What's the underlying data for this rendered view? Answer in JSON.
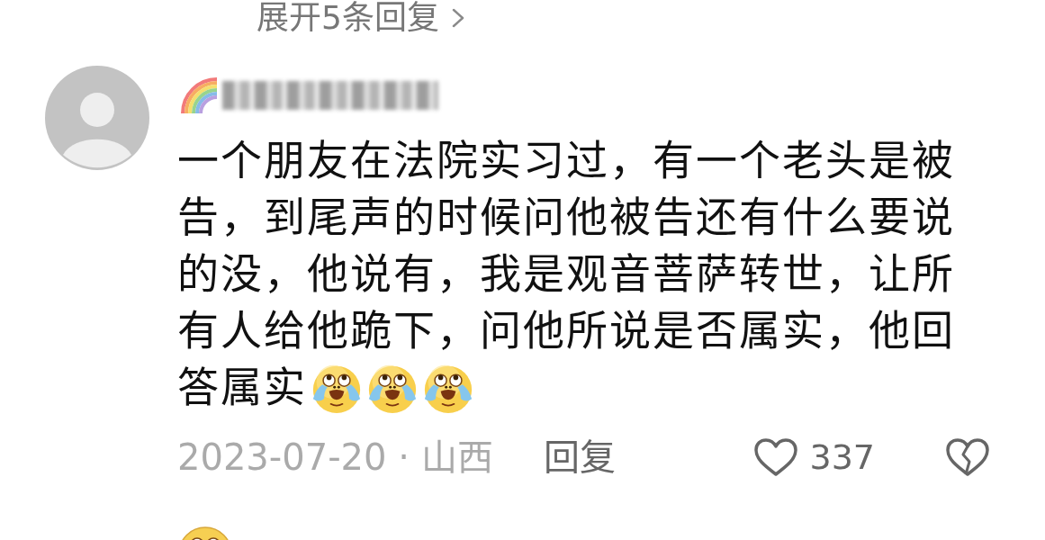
{
  "expand_replies": {
    "label": "展开5条回复"
  },
  "comment": {
    "lines": [
      "一个朋友在法院实习过，有一个老头是被",
      "告，到尾声的时候问他被告还有什么要说",
      "的没，他说有，我是观音菩萨转世，让所",
      "有人给他跪下，问他所说是否属实，他回",
      "答属实"
    ],
    "emojis": [
      {
        "kind": "laugh-cry"
      },
      {
        "kind": "laugh-cry"
      },
      {
        "kind": "laugh-cry"
      }
    ],
    "date_location": "2023-07-20 · 山西",
    "reply_label": "回复",
    "like_count": "337",
    "liked": false
  }
}
